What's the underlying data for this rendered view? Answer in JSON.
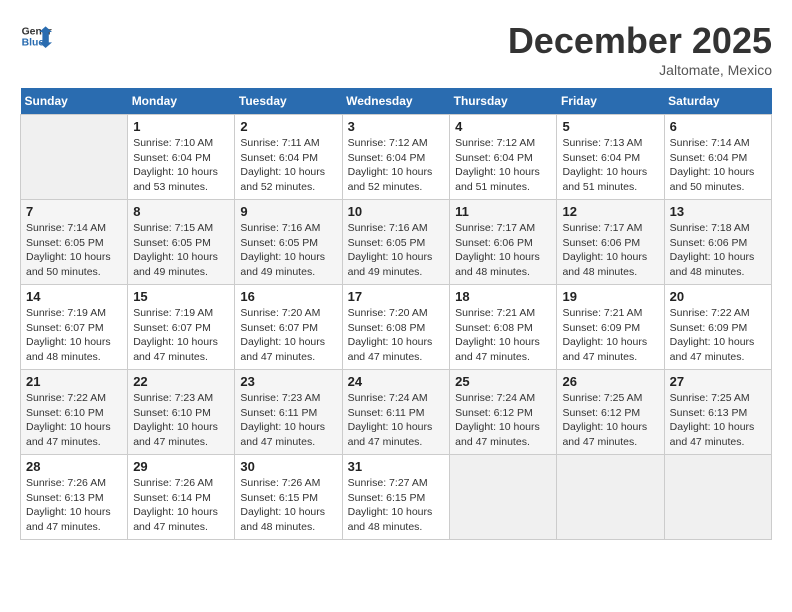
{
  "header": {
    "logo_line1": "General",
    "logo_line2": "Blue",
    "month": "December 2025",
    "location": "Jaltomate, Mexico"
  },
  "weekdays": [
    "Sunday",
    "Monday",
    "Tuesday",
    "Wednesday",
    "Thursday",
    "Friday",
    "Saturday"
  ],
  "weeks": [
    [
      {
        "day": "",
        "content": ""
      },
      {
        "day": "1",
        "content": "Sunrise: 7:10 AM\nSunset: 6:04 PM\nDaylight: 10 hours\nand 53 minutes."
      },
      {
        "day": "2",
        "content": "Sunrise: 7:11 AM\nSunset: 6:04 PM\nDaylight: 10 hours\nand 52 minutes."
      },
      {
        "day": "3",
        "content": "Sunrise: 7:12 AM\nSunset: 6:04 PM\nDaylight: 10 hours\nand 52 minutes."
      },
      {
        "day": "4",
        "content": "Sunrise: 7:12 AM\nSunset: 6:04 PM\nDaylight: 10 hours\nand 51 minutes."
      },
      {
        "day": "5",
        "content": "Sunrise: 7:13 AM\nSunset: 6:04 PM\nDaylight: 10 hours\nand 51 minutes."
      },
      {
        "day": "6",
        "content": "Sunrise: 7:14 AM\nSunset: 6:04 PM\nDaylight: 10 hours\nand 50 minutes."
      }
    ],
    [
      {
        "day": "7",
        "content": "Sunrise: 7:14 AM\nSunset: 6:05 PM\nDaylight: 10 hours\nand 50 minutes."
      },
      {
        "day": "8",
        "content": "Sunrise: 7:15 AM\nSunset: 6:05 PM\nDaylight: 10 hours\nand 49 minutes."
      },
      {
        "day": "9",
        "content": "Sunrise: 7:16 AM\nSunset: 6:05 PM\nDaylight: 10 hours\nand 49 minutes."
      },
      {
        "day": "10",
        "content": "Sunrise: 7:16 AM\nSunset: 6:05 PM\nDaylight: 10 hours\nand 49 minutes."
      },
      {
        "day": "11",
        "content": "Sunrise: 7:17 AM\nSunset: 6:06 PM\nDaylight: 10 hours\nand 48 minutes."
      },
      {
        "day": "12",
        "content": "Sunrise: 7:17 AM\nSunset: 6:06 PM\nDaylight: 10 hours\nand 48 minutes."
      },
      {
        "day": "13",
        "content": "Sunrise: 7:18 AM\nSunset: 6:06 PM\nDaylight: 10 hours\nand 48 minutes."
      }
    ],
    [
      {
        "day": "14",
        "content": "Sunrise: 7:19 AM\nSunset: 6:07 PM\nDaylight: 10 hours\nand 48 minutes."
      },
      {
        "day": "15",
        "content": "Sunrise: 7:19 AM\nSunset: 6:07 PM\nDaylight: 10 hours\nand 47 minutes."
      },
      {
        "day": "16",
        "content": "Sunrise: 7:20 AM\nSunset: 6:07 PM\nDaylight: 10 hours\nand 47 minutes."
      },
      {
        "day": "17",
        "content": "Sunrise: 7:20 AM\nSunset: 6:08 PM\nDaylight: 10 hours\nand 47 minutes."
      },
      {
        "day": "18",
        "content": "Sunrise: 7:21 AM\nSunset: 6:08 PM\nDaylight: 10 hours\nand 47 minutes."
      },
      {
        "day": "19",
        "content": "Sunrise: 7:21 AM\nSunset: 6:09 PM\nDaylight: 10 hours\nand 47 minutes."
      },
      {
        "day": "20",
        "content": "Sunrise: 7:22 AM\nSunset: 6:09 PM\nDaylight: 10 hours\nand 47 minutes."
      }
    ],
    [
      {
        "day": "21",
        "content": "Sunrise: 7:22 AM\nSunset: 6:10 PM\nDaylight: 10 hours\nand 47 minutes."
      },
      {
        "day": "22",
        "content": "Sunrise: 7:23 AM\nSunset: 6:10 PM\nDaylight: 10 hours\nand 47 minutes."
      },
      {
        "day": "23",
        "content": "Sunrise: 7:23 AM\nSunset: 6:11 PM\nDaylight: 10 hours\nand 47 minutes."
      },
      {
        "day": "24",
        "content": "Sunrise: 7:24 AM\nSunset: 6:11 PM\nDaylight: 10 hours\nand 47 minutes."
      },
      {
        "day": "25",
        "content": "Sunrise: 7:24 AM\nSunset: 6:12 PM\nDaylight: 10 hours\nand 47 minutes."
      },
      {
        "day": "26",
        "content": "Sunrise: 7:25 AM\nSunset: 6:12 PM\nDaylight: 10 hours\nand 47 minutes."
      },
      {
        "day": "27",
        "content": "Sunrise: 7:25 AM\nSunset: 6:13 PM\nDaylight: 10 hours\nand 47 minutes."
      }
    ],
    [
      {
        "day": "28",
        "content": "Sunrise: 7:26 AM\nSunset: 6:13 PM\nDaylight: 10 hours\nand 47 minutes."
      },
      {
        "day": "29",
        "content": "Sunrise: 7:26 AM\nSunset: 6:14 PM\nDaylight: 10 hours\nand 47 minutes."
      },
      {
        "day": "30",
        "content": "Sunrise: 7:26 AM\nSunset: 6:15 PM\nDaylight: 10 hours\nand 48 minutes."
      },
      {
        "day": "31",
        "content": "Sunrise: 7:27 AM\nSunset: 6:15 PM\nDaylight: 10 hours\nand 48 minutes."
      },
      {
        "day": "",
        "content": ""
      },
      {
        "day": "",
        "content": ""
      },
      {
        "day": "",
        "content": ""
      }
    ]
  ]
}
